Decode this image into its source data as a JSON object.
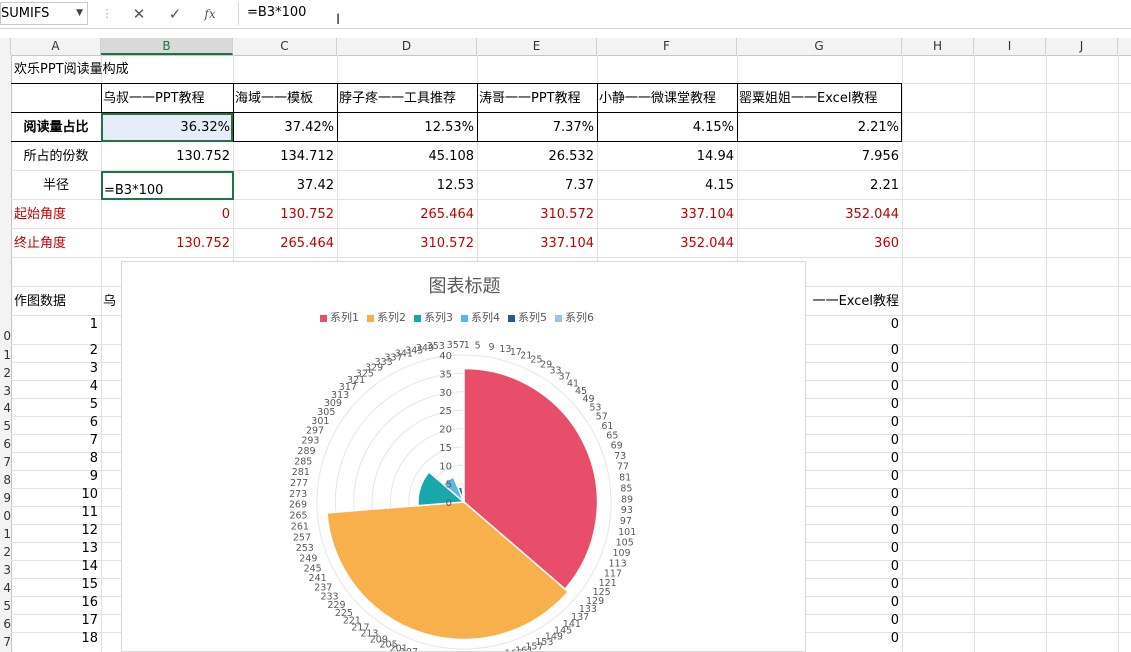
{
  "formula_bar": {
    "name_box": "SUMIFS",
    "cancel_glyph": "✕",
    "enter_glyph": "✓",
    "fx_label": "fx",
    "formula": "=B3*100"
  },
  "columns": [
    "A",
    "B",
    "C",
    "D",
    "E",
    "F",
    "G",
    "H",
    "I",
    "J"
  ],
  "row_numbers": [
    "0",
    "1",
    "2",
    "3",
    "4",
    "5",
    "6",
    "7",
    "8",
    "9",
    "0",
    "1",
    "2",
    "3",
    "4",
    "5",
    "6",
    "7"
  ],
  "sheet": {
    "title": "欢乐PPT阅读量构成",
    "headers": [
      "乌叔一一PPT教程",
      "海域一一模板",
      "脖子疼一一工具推荐",
      "涛哥一一PPT教程",
      "小静一一微课堂教程",
      "罂粟姐姐一一Excel教程"
    ],
    "share": {
      "label": "阅读量占比",
      "values": [
        "36.32%",
        "37.42%",
        "12.53%",
        "7.37%",
        "4.15%",
        "2.21%"
      ]
    },
    "portion": {
      "label": "所占的份数",
      "values": [
        "130.752",
        "134.712",
        "45.108",
        "26.532",
        "14.94",
        "7.956"
      ]
    },
    "radius": {
      "label": "半径",
      "values": [
        "=B3*100",
        "37.42",
        "12.53",
        "7.37",
        "4.15",
        "2.21"
      ]
    },
    "start_angle": {
      "label": "起始角度",
      "values": [
        "0",
        "130.752",
        "265.464",
        "310.572",
        "337.104",
        "352.044"
      ]
    },
    "end_angle": {
      "label": "终止角度",
      "values": [
        "130.752",
        "265.464",
        "310.572",
        "337.104",
        "352.044",
        "360"
      ]
    },
    "plot_label": "作图数据",
    "plot_b_partial": "乌",
    "plot_g_header_partial": "一一Excel教程",
    "plot_index": [
      "1",
      "2",
      "3",
      "4",
      "5",
      "6",
      "7",
      "8",
      "9",
      "10",
      "11",
      "12",
      "13",
      "14",
      "15",
      "16",
      "17",
      "18"
    ],
    "plot_g_values": [
      "0",
      "0",
      "0",
      "0",
      "0",
      "0",
      "0",
      "0",
      "0",
      "0",
      "0",
      "0",
      "0",
      "0",
      "0",
      "0",
      "0",
      "0"
    ]
  },
  "chart_data": {
    "type": "radar-filled",
    "title": "图表标题",
    "series": [
      {
        "name": "系列1",
        "color": "#e84e6a",
        "radius": 36.32,
        "start_angle": 0,
        "end_angle": 130.752
      },
      {
        "name": "系列2",
        "color": "#f8b04c",
        "radius": 37.42,
        "start_angle": 130.752,
        "end_angle": 265.464
      },
      {
        "name": "系列3",
        "color": "#1aa7a9",
        "radius": 12.53,
        "start_angle": 265.464,
        "end_angle": 310.572
      },
      {
        "name": "系列4",
        "color": "#59b8e6",
        "radius": 7.37,
        "start_angle": 310.572,
        "end_angle": 337.104
      },
      {
        "name": "系列5",
        "color": "#2c5d8a",
        "radius": 4.15,
        "start_angle": 337.104,
        "end_angle": 352.044
      },
      {
        "name": "系列6",
        "color": "#9ec3e6",
        "radius": 2.21,
        "start_angle": 352.044,
        "end_angle": 360
      }
    ],
    "radial_ticks": [
      "0",
      "5",
      "10",
      "15",
      "20",
      "25",
      "30",
      "35",
      "40"
    ],
    "radial_max": 40,
    "angle_tick_step": 4,
    "angle_tick_first": 1,
    "angle_tick_last": 357
  }
}
